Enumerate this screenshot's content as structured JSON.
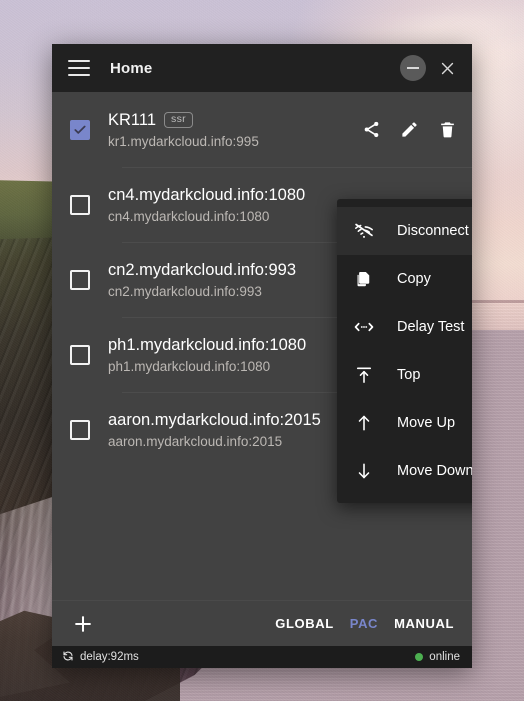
{
  "window": {
    "title": "Home",
    "menu_icon": "hamburger-icon",
    "minimize_icon": "minimize-icon",
    "close_icon": "close-icon"
  },
  "servers": [
    {
      "checked": true,
      "name": "KR111",
      "badge": "ssr",
      "address": "kr1.mydarkcloud.info:995",
      "actions": [
        "share-icon",
        "edit-icon",
        "delete-icon"
      ]
    },
    {
      "checked": false,
      "name": "cn4.mydarkcloud.info:1080",
      "badge": "",
      "address": "cn4.mydarkcloud.info:1080",
      "actions": []
    },
    {
      "checked": false,
      "name": "cn2.mydarkcloud.info:993",
      "badge": "",
      "address": "cn2.mydarkcloud.info:993",
      "actions": []
    },
    {
      "checked": false,
      "name": "ph1.mydarkcloud.info:1080",
      "badge": "",
      "address": "ph1.mydarkcloud.info:1080",
      "actions": []
    },
    {
      "checked": false,
      "name": "aaron.mydarkcloud.info:2015",
      "badge": "",
      "address": "aaron.mydarkcloud.info:2015",
      "actions": []
    }
  ],
  "context_menu": [
    {
      "label": "Disconnect",
      "icon": "wifi-off-icon",
      "highlighted": true
    },
    {
      "label": "Copy",
      "icon": "copy-icon",
      "highlighted": false
    },
    {
      "label": "Delay Test",
      "icon": "delay-test-icon",
      "highlighted": false
    },
    {
      "label": "Top",
      "icon": "move-top-icon",
      "highlighted": false
    },
    {
      "label": "Move Up",
      "icon": "arrow-up-icon",
      "highlighted": false
    },
    {
      "label": "Move Down",
      "icon": "arrow-down-icon",
      "highlighted": false
    }
  ],
  "toolbar": {
    "add_label": "+",
    "add_icon": "plus-icon",
    "tabs": [
      {
        "label": "GLOBAL",
        "active": false
      },
      {
        "label": "PAC",
        "active": true
      },
      {
        "label": "MANUAL",
        "active": false
      }
    ]
  },
  "statusbar": {
    "refresh_icon": "refresh-icon",
    "delay": "delay:92ms",
    "connection": "online",
    "online_color": "#4caf50"
  },
  "colors": {
    "accent": "#7986cb",
    "window_bg": "#424242",
    "titlebar_bg": "#212121",
    "menu_bg": "#212121",
    "statusbar_bg": "#1c1c1c"
  }
}
